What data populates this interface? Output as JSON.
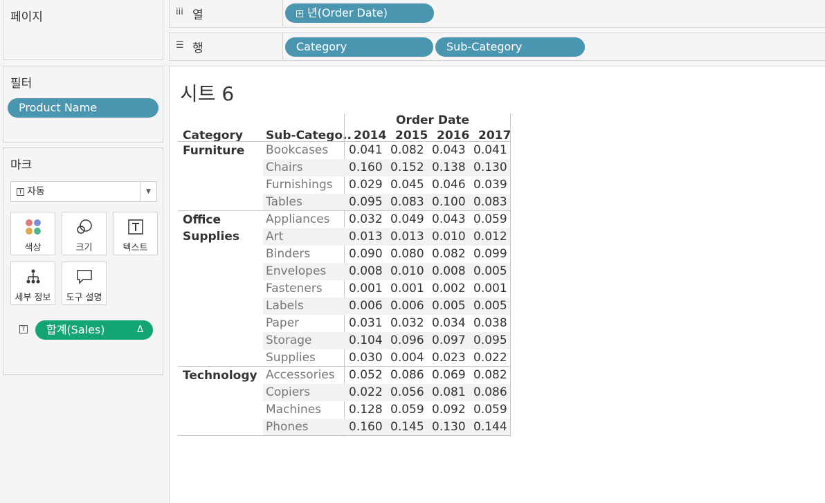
{
  "pages_panel": {
    "title": "페이지"
  },
  "filters_panel": {
    "title": "필터",
    "pills": [
      "Product Name"
    ]
  },
  "marks_panel": {
    "title": "마크",
    "mark_type": "자동",
    "buttons": [
      {
        "label": "색상",
        "icon": "color-icon"
      },
      {
        "label": "크기",
        "icon": "size-icon"
      },
      {
        "label": "텍스트",
        "icon": "text-icon"
      },
      {
        "label": "세부 정보",
        "icon": "detail-icon"
      },
      {
        "label": "도구 설명",
        "icon": "tooltip-icon"
      }
    ],
    "measure_pill": {
      "label": "합계(Sales)",
      "delta": "Δ"
    }
  },
  "columns_shelf": {
    "label": "열",
    "pills": [
      "년(Order Date)"
    ]
  },
  "rows_shelf": {
    "label": "행",
    "pills": [
      "Category",
      "Sub-Category"
    ]
  },
  "sheet": {
    "title": "시트 6",
    "header": {
      "category": "Category",
      "subcategory": "Sub-Catego..",
      "column_group": "Order Date",
      "years": [
        "2014",
        "2015",
        "2016",
        "2017"
      ]
    },
    "groups": [
      {
        "category": "Furniture",
        "rows": [
          {
            "sub": "Bookcases",
            "values": [
              "0.041",
              "0.082",
              "0.043",
              "0.041"
            ]
          },
          {
            "sub": "Chairs",
            "values": [
              "0.160",
              "0.152",
              "0.138",
              "0.130"
            ]
          },
          {
            "sub": "Furnishings",
            "values": [
              "0.029",
              "0.045",
              "0.046",
              "0.039"
            ]
          },
          {
            "sub": "Tables",
            "values": [
              "0.095",
              "0.083",
              "0.100",
              "0.083"
            ]
          }
        ]
      },
      {
        "category": "Office Supplies",
        "rows": [
          {
            "sub": "Appliances",
            "values": [
              "0.032",
              "0.049",
              "0.043",
              "0.059"
            ]
          },
          {
            "sub": "Art",
            "values": [
              "0.013",
              "0.013",
              "0.010",
              "0.012"
            ]
          },
          {
            "sub": "Binders",
            "values": [
              "0.090",
              "0.080",
              "0.082",
              "0.099"
            ]
          },
          {
            "sub": "Envelopes",
            "values": [
              "0.008",
              "0.010",
              "0.008",
              "0.005"
            ]
          },
          {
            "sub": "Fasteners",
            "values": [
              "0.001",
              "0.001",
              "0.002",
              "0.001"
            ]
          },
          {
            "sub": "Labels",
            "values": [
              "0.006",
              "0.006",
              "0.005",
              "0.005"
            ]
          },
          {
            "sub": "Paper",
            "values": [
              "0.031",
              "0.032",
              "0.034",
              "0.038"
            ]
          },
          {
            "sub": "Storage",
            "values": [
              "0.104",
              "0.096",
              "0.097",
              "0.095"
            ]
          },
          {
            "sub": "Supplies",
            "values": [
              "0.030",
              "0.004",
              "0.023",
              "0.022"
            ]
          }
        ]
      },
      {
        "category": "Technology",
        "rows": [
          {
            "sub": "Accessories",
            "values": [
              "0.052",
              "0.086",
              "0.069",
              "0.082"
            ]
          },
          {
            "sub": "Copiers",
            "values": [
              "0.022",
              "0.056",
              "0.081",
              "0.086"
            ]
          },
          {
            "sub": "Machines",
            "values": [
              "0.128",
              "0.059",
              "0.092",
              "0.059"
            ]
          },
          {
            "sub": "Phones",
            "values": [
              "0.160",
              "0.145",
              "0.130",
              "0.144"
            ]
          }
        ]
      }
    ]
  },
  "colors": {
    "dimension_pill": "#4a96b0",
    "measure_pill": "#13a573"
  }
}
